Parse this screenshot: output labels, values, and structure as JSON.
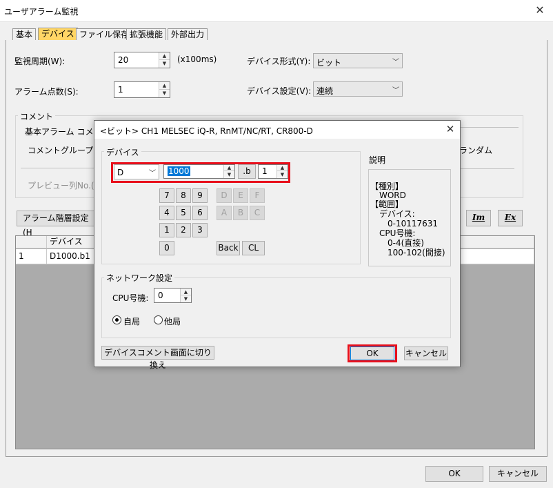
{
  "window": {
    "title": "ユーザアラーム監視",
    "close_glyph": "✕"
  },
  "tabs": [
    {
      "label": "基本"
    },
    {
      "label": "デバイス"
    },
    {
      "label": "ファイル保存"
    },
    {
      "label": "拡張機能"
    },
    {
      "label": "外部出力"
    }
  ],
  "form": {
    "period_label": "監視周期(W):",
    "period_value": "20",
    "period_unit": "(x100ms)",
    "device_format_label": "デバイス形式(Y):",
    "device_format_value": "ビット",
    "alarm_count_label": "アラーム点数(S):",
    "alarm_count_value": "1",
    "device_setting_label": "デバイス設定(V):",
    "device_setting_value": "連続"
  },
  "comment": {
    "group_label": "コメント",
    "basic_label": "基本アラーム コメント",
    "group_no_label": "コメントグループNo.(",
    "random_label": "ランダム",
    "preview_label": "プレビュー列No.(R):"
  },
  "toolbar": {
    "hierarchy_label": "アラーム階層設定(H",
    "im_label": "Im",
    "ex_label": "Ex"
  },
  "grid": {
    "columns": [
      "",
      "デバイス"
    ],
    "rows": [
      {
        "no": "1",
        "device": "D1000.b1"
      }
    ]
  },
  "footer": {
    "ok_label": "OK",
    "cancel_label": "キャンセル"
  },
  "dialog": {
    "title": "<ビット> CH1 MELSEC iQ-R, RnMT/NC/RT, CR800-D",
    "close_glyph": "✕",
    "device_group": "デバイス",
    "device_type": "D",
    "device_number": "1000",
    "bit_sep": ".b",
    "bit_value": "1",
    "keypad": {
      "row1": [
        "7",
        "8",
        "9"
      ],
      "row2": [
        "4",
        "5",
        "6"
      ],
      "row3": [
        "1",
        "2",
        "3"
      ],
      "zero": "0",
      "hex_row1": [
        "D",
        "E",
        "F"
      ],
      "hex_row2": [
        "A",
        "B",
        "C"
      ],
      "back": "Back",
      "clear": "CL"
    },
    "explanation_label": "説明",
    "explanation": {
      "type_header": "【種別】",
      "type_value": "WORD",
      "range_header": "【範囲】",
      "device_label": "デバイス:",
      "device_range": "0-10117631",
      "cpu_label": "CPU号機:",
      "cpu_direct": "0-4(直接)",
      "cpu_indirect": "100-102(間接)"
    },
    "network_group": "ネットワーク設定",
    "cpu_no_label": "CPU号機:",
    "cpu_no_value": "0",
    "radio_own": "自局",
    "radio_other": "他局",
    "switch_button": "デバイスコメント画面に切り換え",
    "ok_label": "OK",
    "cancel_label": "キャンセル"
  }
}
